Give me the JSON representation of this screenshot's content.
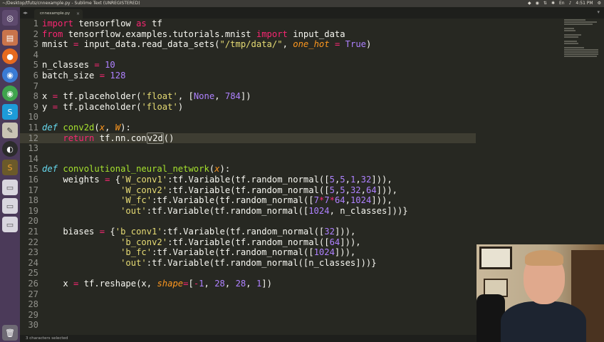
{
  "window": {
    "title": "~/Desktop/tfuts/cnnexample.py - Sublime Text (UNREGISTERED)",
    "clock": "4:51 PM"
  },
  "tab": {
    "label": "cnnexample.py",
    "close": "×"
  },
  "status": {
    "text": "3 characters selected"
  },
  "launcher": [
    "dash",
    "files",
    "firefox",
    "chromium",
    "chrome",
    "skype",
    "editor",
    "obs",
    "sublime",
    "drive1",
    "drive2",
    "drive3",
    "trash"
  ],
  "line_numbers": [
    "1",
    "2",
    "3",
    "4",
    "5",
    "6",
    "7",
    "8",
    "9",
    "10",
    "11",
    "12",
    "13",
    "14",
    "15",
    "16",
    "17",
    "18",
    "19",
    "20",
    "21",
    "22",
    "23",
    "24",
    "25",
    "26",
    "27",
    "28",
    "29",
    "30"
  ],
  "code": {
    "l1": [
      "import",
      " tensorflow ",
      "as",
      " tf"
    ],
    "l2": [
      "from",
      " tensorflow.examples.tutorials.mnist ",
      "import",
      " input_data"
    ],
    "l3": [
      "mnist ",
      "=",
      " input_data.read_data_sets(",
      "\"/tmp/data/\"",
      ", ",
      "one_hot",
      " ",
      "=",
      " ",
      "True",
      ")"
    ],
    "l5": [
      "n_classes ",
      "=",
      " ",
      "10"
    ],
    "l6": [
      "batch_size ",
      "=",
      " ",
      "128"
    ],
    "l8": [
      "x ",
      "=",
      " tf.placeholder(",
      "'float'",
      ", [",
      "None",
      ", ",
      "784",
      "])"
    ],
    "l9": [
      "y ",
      "=",
      " tf.placeholder(",
      "'float'",
      ")"
    ],
    "l11": [
      "def",
      " ",
      "conv2d",
      "(",
      "x",
      ", ",
      "W",
      "):"
    ],
    "l12": [
      "    ",
      "return",
      " tf.nn.con",
      "v2d",
      "()"
    ],
    "l15": [
      "def",
      " ",
      "convolutional_neural_network",
      "(",
      "x",
      "):"
    ],
    "l16": [
      "    weights ",
      "=",
      " {",
      "'W_conv1'",
      ":tf.Variable(tf.random_normal([",
      "5",
      ",",
      "5",
      ",",
      "1",
      ",",
      "32",
      "])),"
    ],
    "l17": [
      "               ",
      "'W_conv2'",
      ":tf.Variable(tf.random_normal([",
      "5",
      ",",
      "5",
      ",",
      "32",
      ",",
      "64",
      "])),"
    ],
    "l18": [
      "               ",
      "'W_fc'",
      ":tf.Variable(tf.random_normal([",
      "7",
      "*",
      "7",
      "*",
      "64",
      ",",
      "1024",
      "])),"
    ],
    "l19": [
      "               ",
      "'out'",
      ":tf.Variable(tf.random_normal([",
      "1024",
      ", n_classes]))}"
    ],
    "l21": [
      "    biases ",
      "=",
      " {",
      "'b_conv1'",
      ":tf.Variable(tf.random_normal([",
      "32",
      "])),"
    ],
    "l22": [
      "               ",
      "'b_conv2'",
      ":tf.Variable(tf.random_normal([",
      "64",
      "])),"
    ],
    "l23": [
      "               ",
      "'b_fc'",
      ":tf.Variable(tf.random_normal([",
      "1024",
      "])),"
    ],
    "l24": [
      "               ",
      "'out'",
      ":tf.Variable(tf.random_normal([n_classes]))}"
    ],
    "l26": [
      "    x ",
      "=",
      " tf.reshape(x, ",
      "shape",
      "=",
      "[",
      "-",
      "1",
      ", ",
      "28",
      ", ",
      "28",
      ", ",
      "1",
      "])"
    ]
  }
}
